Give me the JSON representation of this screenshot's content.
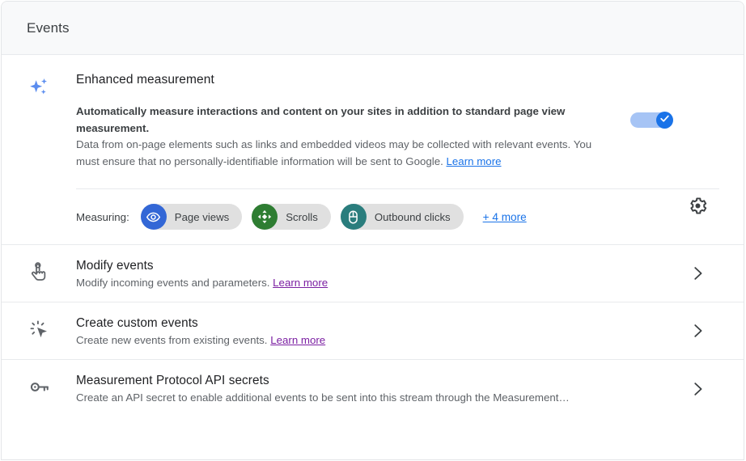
{
  "header": {
    "title": "Events"
  },
  "enhanced_measurement": {
    "icon": "sparkle-icon",
    "heading": "Enhanced measurement",
    "desc_strong": "Automatically measure interactions and content on your sites in addition to standard page view measurement.",
    "desc_rest_1": "Data from on-page elements such as links and embedded videos may be collected with relevant events. You must ensure that no personally-identifiable information will be sent to Google. ",
    "learn_more": "Learn more",
    "toggle": {
      "state": "on",
      "icon": "check-icon",
      "track_color": "#a6c4f5",
      "thumb_color": "#1a73e8"
    },
    "measuring_label": "Measuring:",
    "chips": [
      {
        "label": "Page views",
        "icon": "eye-icon",
        "color": "#3367d6"
      },
      {
        "label": "Scrolls",
        "icon": "scroll-move-icon",
        "color": "#2e7d32"
      },
      {
        "label": "Outbound clicks",
        "icon": "mouse-icon",
        "color": "#2a7d7d"
      }
    ],
    "more_link": "+ 4 more",
    "settings_icon": "gear-icon"
  },
  "rows": [
    {
      "icon": "touch-tap-icon",
      "title": "Modify events",
      "sub_text": "Modify incoming events and parameters. ",
      "link": "Learn more",
      "chevron": "chevron-right-icon"
    },
    {
      "icon": "ads-click-icon",
      "title": "Create custom events",
      "sub_text": "Create new events from existing events. ",
      "link": "Learn more",
      "chevron": "chevron-right-icon"
    },
    {
      "icon": "key-icon",
      "title": "Measurement Protocol API secrets",
      "sub_text": "Create an API secret to enable additional events to be sent into this stream through the Measurement…",
      "link": "",
      "chevron": "chevron-right-icon"
    }
  ],
  "colors": {
    "accent": "#1a73e8",
    "visited_link": "#7b1fa2",
    "header_bg": "#f8f9fa",
    "divider": "#e8eaed",
    "text_primary": "#202124",
    "text_secondary": "#5f6368"
  }
}
